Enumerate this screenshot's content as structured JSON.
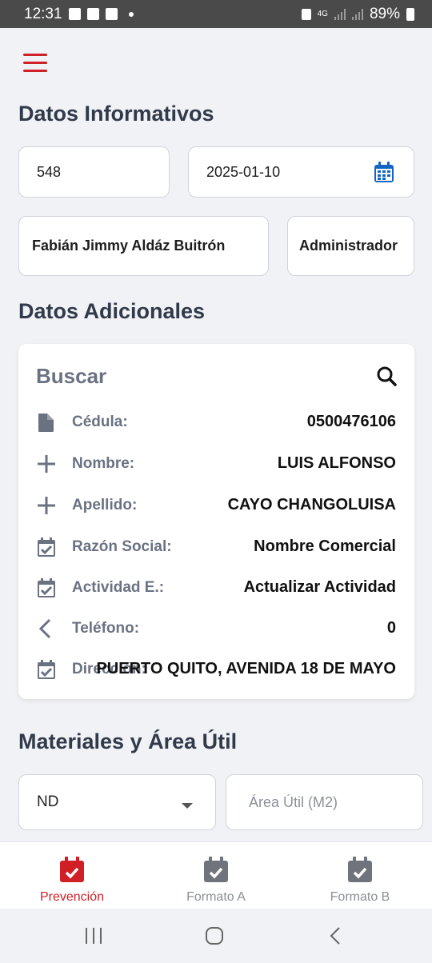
{
  "status_bar": {
    "time": "12:31",
    "network": "4G",
    "battery": "89%"
  },
  "sections": {
    "informativos": "Datos Informativos",
    "adicionales": "Datos Adicionales",
    "materiales": "Materiales y Área Útil"
  },
  "info": {
    "number": "548",
    "date": "2025-01-10",
    "name": "Fabián Jimmy Aldáz Buitrón",
    "role": "Administrador"
  },
  "search": {
    "label": "Buscar"
  },
  "rows": [
    {
      "label": "Cédula:",
      "value": "0500476106",
      "icon": "document-icon"
    },
    {
      "label": "Nombre:",
      "value": "LUIS ALFONSO",
      "icon": "plus-icon"
    },
    {
      "label": "Apellido:",
      "value": "CAYO CHANGOLUISA",
      "icon": "plus-icon"
    },
    {
      "label": "Razón Social:",
      "value": "Nombre Comercial",
      "icon": "calendar-check-icon"
    },
    {
      "label": "Actividad E.:",
      "value": "Actualizar Actividad",
      "icon": "calendar-check-icon"
    },
    {
      "label": "Teléfono:",
      "value": "0",
      "icon": "chevron-left-icon"
    },
    {
      "label": "Dirección:",
      "value": "PUERTO QUITO, AVENIDA 18 DE MAYO",
      "icon": "calendar-check-icon"
    }
  ],
  "materials": {
    "select_value": "ND",
    "area_placeholder": "Área Útil (M2)"
  },
  "nav": [
    {
      "label": "Prevención",
      "active": true
    },
    {
      "label": "Formato A",
      "active": false
    },
    {
      "label": "Formato B",
      "active": false
    }
  ],
  "colors": {
    "accent": "#d11f26",
    "calendar": "#1565c0",
    "title": "#313a4a",
    "muted": "#6a7282"
  }
}
